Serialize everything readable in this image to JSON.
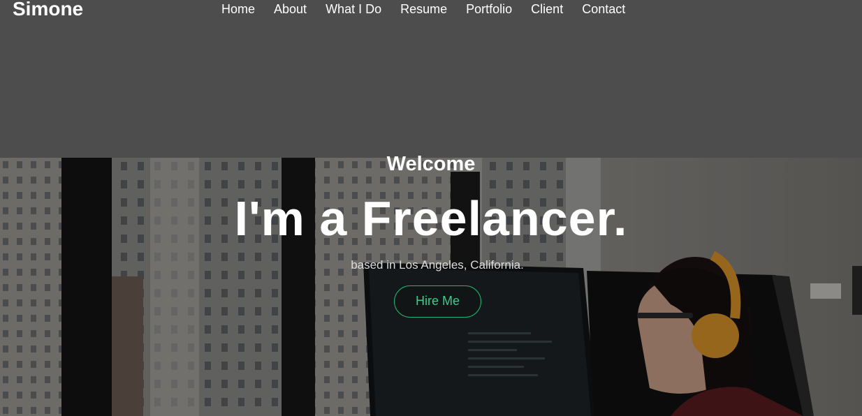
{
  "brand": {
    "name": "Simone"
  },
  "nav": {
    "items": [
      {
        "label": "Home"
      },
      {
        "label": "About"
      },
      {
        "label": "What I Do"
      },
      {
        "label": "Resume"
      },
      {
        "label": "Portfolio"
      },
      {
        "label": "Client"
      },
      {
        "label": "Contact"
      }
    ]
  },
  "hero": {
    "welcome": "Welcome",
    "headline": "I'm a Freelancer.",
    "subline": "based in Los Angeles, California.",
    "cta_label": "Hire Me"
  },
  "colors": {
    "header_bg": "#4d4d4d",
    "accent": "#22b573",
    "text": "#ffffff"
  }
}
